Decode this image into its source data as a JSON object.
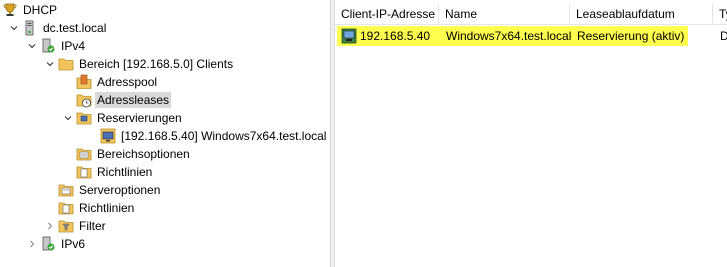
{
  "tree": {
    "root": "DHCP",
    "server": "dc.test.local",
    "ipv4": "IPv4",
    "scope": "Bereich [192.168.5.0] Clients",
    "address_pool": "Adresspool",
    "address_leases": "Adressleases",
    "reservations": "Reservierungen",
    "reservation_item": "[192.168.5.40] Windows7x64.test.local",
    "scope_options": "Bereichsoptionen",
    "scope_policies": "Richtlinien",
    "server_options": "Serveroptionen",
    "policies": "Richtlinien",
    "filter": "Filter",
    "ipv6": "IPv6"
  },
  "list": {
    "columns": [
      "Client-IP-Adresse",
      "Name",
      "Leaseablaufdatum",
      "Ty"
    ],
    "rows": [
      {
        "ip": "192.168.5.40",
        "name": "Windows7x64.test.local",
        "lease_expiry": "Reservierung (aktiv)",
        "type": "D"
      }
    ],
    "highlight_color": "#ffff4d"
  },
  "colors": {
    "selection": "#d9d9d9",
    "folder": "#f2c55c",
    "server_green": "#3aa335"
  }
}
